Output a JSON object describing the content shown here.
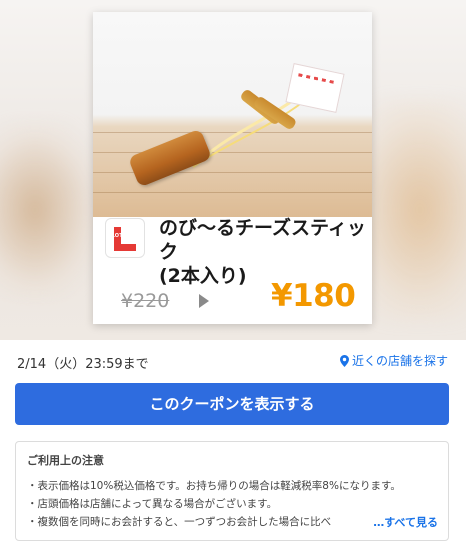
{
  "coupon": {
    "product_name_line1": "のび〜るチーズスティック",
    "product_name_line2": "(2本入り)",
    "original_price": "¥220",
    "discount_price": "¥180",
    "brand_logo_text": "LOTTERIA",
    "brand_colors": {
      "primary": "#e53935",
      "secondary": "#f6b51e"
    }
  },
  "deadline": {
    "text": "2/14（火）23:59まで"
  },
  "nearby": {
    "label": "近くの店舗を探す",
    "icon": "location-pin-icon"
  },
  "actions": {
    "show_coupon_label": "このクーポンを表示する"
  },
  "notes": {
    "title": "ご利用上の注意",
    "items": [
      "・表示価格は10%税込価格です。お持ち帰りの場合は軽減税率8%になります。",
      "・店頭価格は店舗によって異なる場合がございます。",
      "・複数個を同時にお会計すると、一つずつお会計した場合に比べ"
    ],
    "see_all_label": "…すべて見る"
  },
  "colors": {
    "accent_blue": "#2e6cdf",
    "price_orange": "#f39800",
    "link_blue": "#1a73e8"
  }
}
